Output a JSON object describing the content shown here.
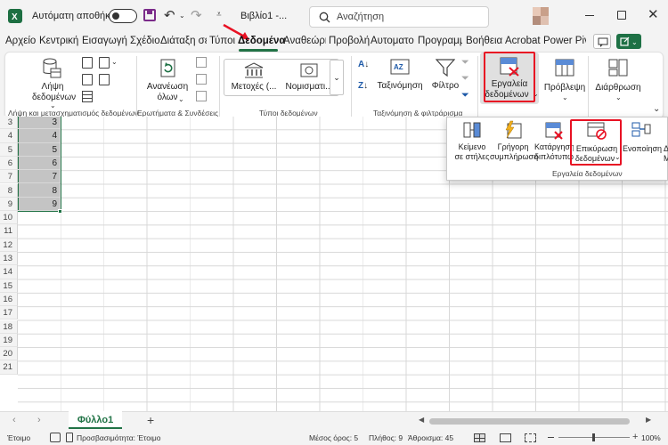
{
  "titlebar": {
    "app_icon": "excel-icon",
    "autosave_label": "Αυτόματη αποθήκευση",
    "autosave_state": "off",
    "doc_title": "Βιβλίο1  -...",
    "search_placeholder": "Αναζήτηση"
  },
  "tabs": [
    "Αρχείο",
    "Κεντρική",
    "Εισαγωγή",
    "Σχέδιο",
    "Διάταξη σε",
    "Τύποι",
    "Δεδομένα",
    "Αναθεώρη",
    "Προβολή",
    "Αυτοματο",
    "Προγραμμ",
    "Βοήθεια",
    "Acrobat",
    "Power Pivo"
  ],
  "active_tab": "Δεδομένα",
  "ribbon": {
    "get_data": {
      "label_line1": "Λήψη",
      "label_line2": "δεδομένων"
    },
    "refresh": {
      "label_line1": "Ανανέωση",
      "label_line2": "όλων"
    },
    "data_types": {
      "stocks": "Μετοχές (...",
      "currencies": "Νομισματι..."
    },
    "sort": "Ταξινόμηση",
    "filter": "Φίλτρο",
    "data_tools": {
      "label_line1": "Εργαλεία",
      "label_line2": "δεδομένων"
    },
    "forecast": "Πρόβλεψη",
    "outline": "Διάρθρωση",
    "groups": {
      "get_transform": "Λήψη και μετασχηματισμός δεδομένων",
      "queries": "Ερωτήματα & Συνδέσεις",
      "data_types": "Τύποι δεδομένων",
      "sort_filter": "Ταξινόμηση & φιλτράρισμα"
    }
  },
  "popup": {
    "text_to_columns": {
      "line1": "Κείμενο",
      "line2": "σε στήλες"
    },
    "flash_fill": {
      "line1": "Γρήγορη",
      "line2": "συμπλήρωση"
    },
    "remove_duplicates": {
      "line1": "Κατάργηση",
      "line2": "διπλότυπων"
    },
    "data_validation": {
      "line1": "Επικύρωση",
      "line2": "δεδομένων"
    },
    "consolidate": "Ενοποίηση",
    "more_line1": "Δ",
    "more_line2": "Μ",
    "group_label": "Εργαλεία δεδομένων"
  },
  "sheet": {
    "row_numbers": [
      "3",
      "4",
      "5",
      "6",
      "7",
      "8",
      "9",
      "10",
      "11",
      "12",
      "13",
      "14",
      "15",
      "16",
      "17",
      "18",
      "19",
      "20",
      "21"
    ],
    "values": [
      "3",
      "4",
      "5",
      "6",
      "7",
      "8",
      "9"
    ]
  },
  "sheet_tab": "Φύλλο1",
  "status": {
    "ready": "Έτοιμο",
    "accessibility": "Προσβασιμότητα: Έτοιμο",
    "average": "Μέσος όρος: 5",
    "count": "Πλήθος: 9",
    "sum": "Άθροισμα: 45",
    "zoom": "100%"
  },
  "colors": {
    "excel_green": "#217346",
    "highlight_red": "#e81123",
    "selection_gray": "#d0d0d0"
  }
}
